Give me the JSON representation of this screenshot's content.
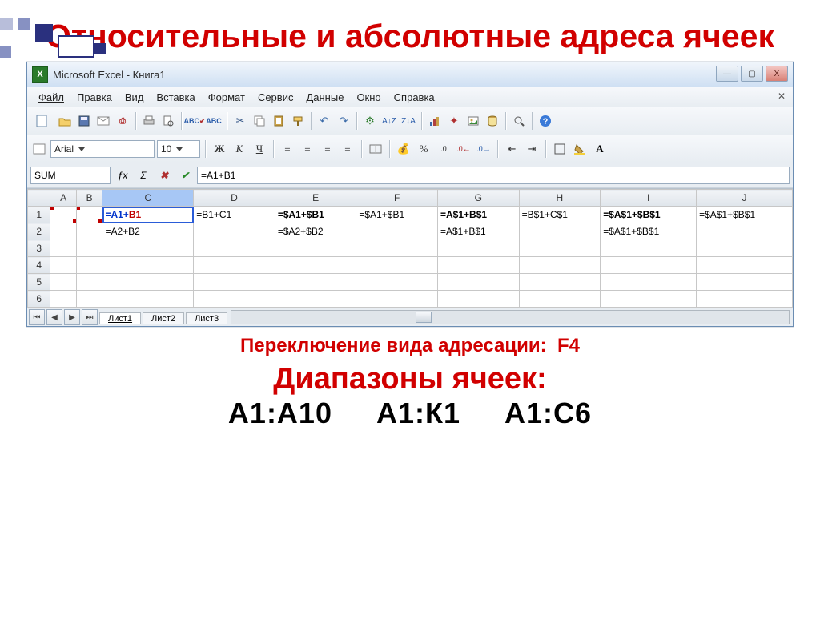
{
  "slide": {
    "title": "Относительные и абсолютные адреса ячеек",
    "switch_label": "Переключение вида адресации:",
    "switch_key": "F4",
    "ranges_head": "Диапазоны ячеек:",
    "range_a": "А1:А10",
    "range_b": "А1:К1",
    "range_c": "А1:С6"
  },
  "window": {
    "title": "Microsoft Excel - Книга1"
  },
  "menu": {
    "file": "Файл",
    "edit": "Правка",
    "view": "Вид",
    "insert": "Вставка",
    "format": "Формат",
    "tools": "Сервис",
    "data": "Данные",
    "window_m": "Окно",
    "help": "Справка"
  },
  "format": {
    "font": "Arial",
    "size": "10",
    "bold": "Ж",
    "italic": "К",
    "underline": "Ч"
  },
  "formulabar": {
    "namebox": "SUM",
    "formula": "=A1+B1"
  },
  "columns": [
    "A",
    "B",
    "C",
    "D",
    "E",
    "F",
    "G",
    "H",
    "I",
    "J"
  ],
  "rows": [
    "1",
    "2",
    "3",
    "4",
    "5",
    "6"
  ],
  "cells": {
    "C1_plain": "=",
    "C1_colA": "A1",
    "C1_plus": "+",
    "C1_colB": "B1",
    "D1": "=B1+C1",
    "E1": "=$A1+$B1",
    "F1": "=$A1+$B1",
    "G1": "=A$1+B$1",
    "H1": "=B$1+C$1",
    "I1": "=$A$1+$B$1",
    "J1": "=$A$1+$B$1",
    "C2": "=A2+B2",
    "E2": "=$A2+$B2",
    "G2": "=A$1+B$1",
    "I2": "=$A$1+$B$1"
  },
  "sheets": {
    "s1": "Лист1",
    "s2": "Лист2",
    "s3": "Лист3"
  }
}
